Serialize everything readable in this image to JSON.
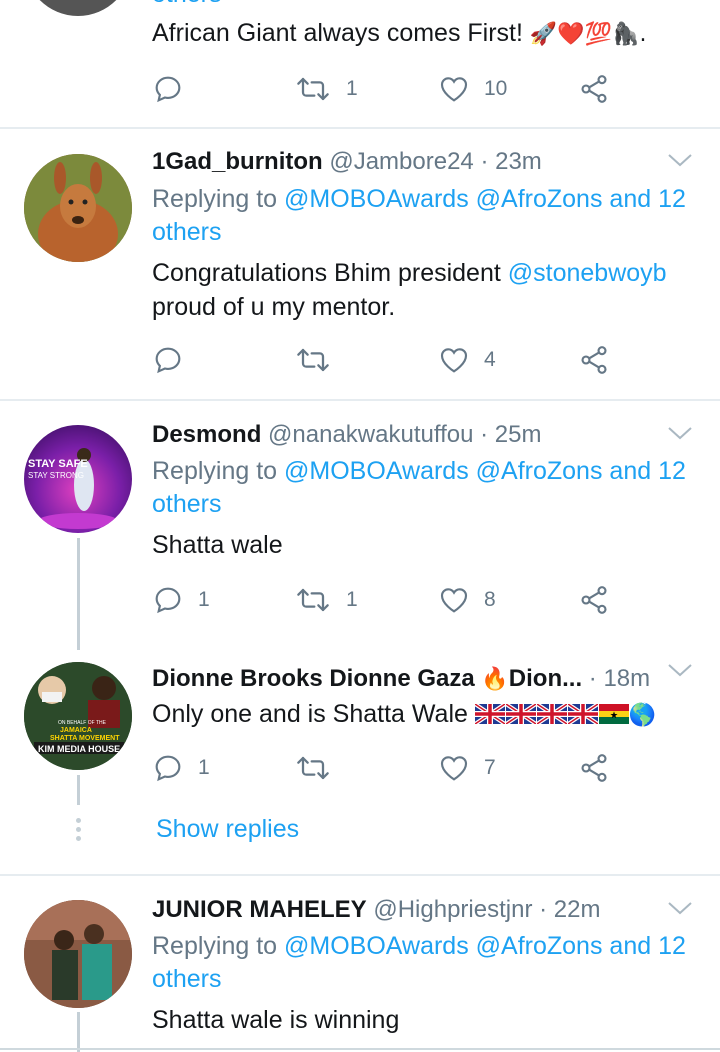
{
  "tweets": [
    {
      "text": "African Giant always comes First!",
      "emoji": "🚀❤️💯🦍.",
      "reply_count": "",
      "retweet_count": "1",
      "like_count": "10"
    },
    {
      "name": "1Gad_burniton",
      "handle": "@Jambore24",
      "time": "· 23m",
      "replying_prefix": "Replying to ",
      "replying_mentions": "@MOBOAwards @AfroZons and 12",
      "replying_others": "others",
      "text_before": "Congratulations Bhim president ",
      "mention": "@stonebwoyb",
      "text_after": "proud of u my mentor.",
      "reply_count": "",
      "retweet_count": "",
      "like_count": "4"
    },
    {
      "name": "Desmond",
      "handle": "@nanakwakutuffou",
      "time": "· 25m",
      "replying_prefix": "Replying to ",
      "replying_mentions": "@MOBOAwards @AfroZons and 12",
      "replying_others": "others",
      "text": "Shatta wale",
      "avatar_text_1": "STAY SAFE",
      "avatar_text_2": "STAY STRONG",
      "reply_count": "1",
      "retweet_count": "1",
      "like_count": "8"
    },
    {
      "name": "Dionne Brooks Dionne Gaza",
      "name_suffix": "Dion...",
      "fire_emoji": "🔥",
      "time": "· 18m",
      "text": "Only one and is Shatta Wale",
      "globe_emoji": "🌎",
      "avatar_text_1": "ON BEHALF OF THE",
      "avatar_text_2": "JAMAICA",
      "avatar_text_3": "SHATTA MOVEMENT",
      "avatar_text_4": "KIM MEDIA HOUSE",
      "reply_count": "1",
      "retweet_count": "",
      "like_count": "7"
    },
    {
      "name": "JUNIOR MAHELEY",
      "handle": "@Highpriestjnr",
      "time": "· 22m",
      "replying_prefix": "Replying to ",
      "replying_mentions": "@MOBOAwards @AfroZons and 12",
      "replying_others": "others",
      "text": "Shatta wale is winning"
    }
  ],
  "show_replies": "Show replies",
  "top_partial_text": "others",
  "colors": {
    "link": "#1da1f2",
    "meta": "#657786",
    "icon": "#657786",
    "divider": "#e6ecf0",
    "thread": "#c4cfd6"
  }
}
